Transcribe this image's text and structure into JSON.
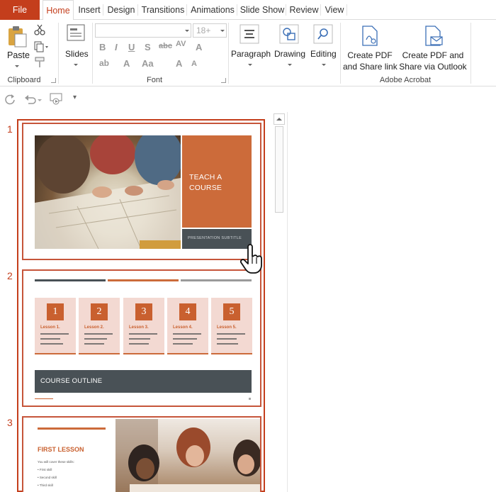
{
  "tabs": [
    {
      "label": "File",
      "active": false
    },
    {
      "label": "Home",
      "active": true
    },
    {
      "label": "Insert",
      "active": false
    },
    {
      "label": "Design",
      "active": false
    },
    {
      "label": "Transitions",
      "active": false
    },
    {
      "label": "Animations",
      "active": false
    },
    {
      "label": "Slide Show",
      "active": false
    },
    {
      "label": "Review",
      "active": false
    },
    {
      "label": "View",
      "active": false
    }
  ],
  "ribbon": {
    "clipboard": {
      "paste": "Paste",
      "group": "Clipboard"
    },
    "slides": {
      "label": "Slides"
    },
    "font": {
      "size_placeholder": "18+",
      "group": "Font"
    },
    "paragraph": {
      "label": "Paragraph"
    },
    "drawing": {
      "label": "Drawing"
    },
    "editing": {
      "label": "Editing"
    },
    "acrobat": {
      "create_pdf_share_line1": "Create PDF",
      "create_pdf_share_line2": "and Share link",
      "create_pdf_outlook_line1": "Create PDF and",
      "create_pdf_outlook_line2": "Share via Outlook",
      "group": "Adobe Acrobat"
    }
  },
  "slides": [
    {
      "number": "1",
      "title_line1": "TEACH A",
      "title_line2": "COURSE",
      "subtitle": "PRESENTATION SUBTITLE"
    },
    {
      "number": "2",
      "lessons": [
        {
          "num": "1",
          "title": "Lesson 1."
        },
        {
          "num": "2",
          "title": "Lesson 2."
        },
        {
          "num": "3",
          "title": "Lesson 3."
        },
        {
          "num": "4",
          "title": "Lesson 4."
        },
        {
          "num": "5",
          "title": "Lesson 5."
        }
      ],
      "banner": "COURSE OUTLINE"
    },
    {
      "number": "3",
      "title": "FIRST LESSON",
      "intro": "You will cover these skills:",
      "bullets": [
        "First skill",
        "Second skill",
        "Third skill"
      ]
    }
  ],
  "colors": {
    "accent": "#c43e1c",
    "slide_orange": "#cc6b3a",
    "slide_dark": "#495156",
    "lesson_bg": "#f3d9d2"
  }
}
